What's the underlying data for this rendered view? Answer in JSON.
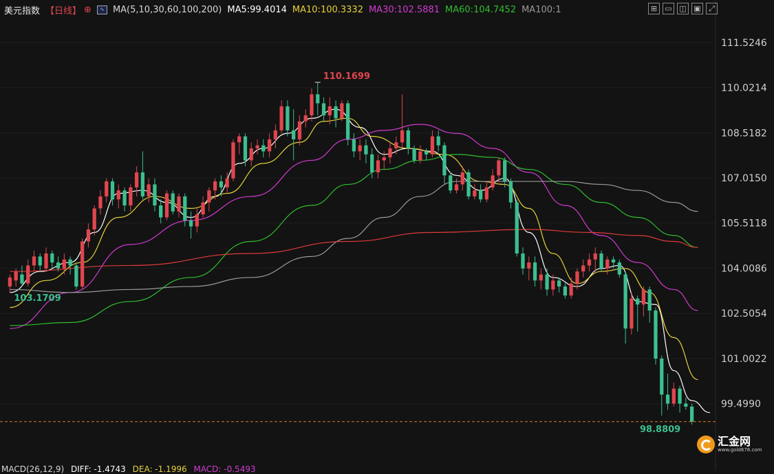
{
  "header": {
    "symbol": "美元指数",
    "period": "【日线】",
    "ma_params": "MA(5,10,30,60,100,200)",
    "ma5": "MA5:99.4014",
    "ma10": "MA10:100.3332",
    "ma30": "MA30:102.5881",
    "ma60": "MA60:104.7452",
    "ma100": "MA100:1"
  },
  "toolbar_icons": [
    "grid-icon",
    "window-icon",
    "split-icon",
    "window-alt-icon",
    "fullscreen-icon"
  ],
  "macd": {
    "params": "MACD(26,12,9)",
    "diff": "DIFF: -1.4743",
    "dea": "DEA: -1.1996",
    "macd": "MACD: -0.5493"
  },
  "price_annotations": {
    "high_label": "110.1699",
    "low_label": "103.1709",
    "last_label": "98.8809"
  },
  "logo": {
    "name": "汇金网",
    "url": "www.gold678.com"
  },
  "colors": {
    "up": "#e0464e",
    "down": "#3cbf8f",
    "ma5": "#ffffff",
    "ma10": "#e6d23a",
    "ma30": "#d23bd2",
    "ma60": "#2fbf2f",
    "ma100": "#9a9a9a",
    "ma200": "#e03a3a",
    "last_price_line": "#e07b2a"
  },
  "chart_data": {
    "type": "candlestick",
    "y_tick_labels": [
      "111.5246",
      "110.0214",
      "108.5182",
      "107.0150",
      "105.5118",
      "104.0086",
      "102.5054",
      "101.0022",
      "99.4990"
    ],
    "ylim": [
      98.3,
      112.3
    ],
    "candles": [
      [
        103.4,
        103.7,
        103.2,
        103.8
      ],
      [
        103.6,
        103.9,
        103.4,
        104.0
      ],
      [
        103.8,
        103.5,
        103.4,
        104.1
      ],
      [
        103.5,
        104.1,
        103.4,
        104.3
      ],
      [
        104.1,
        104.4,
        103.9,
        104.6
      ],
      [
        104.4,
        104.1,
        103.9,
        104.5
      ],
      [
        104.0,
        104.5,
        103.9,
        104.7
      ],
      [
        104.5,
        104.2,
        104.0,
        104.6
      ],
      [
        104.2,
        104.0,
        103.9,
        104.4
      ],
      [
        104.0,
        104.3,
        103.8,
        104.5
      ],
      [
        104.3,
        104.1,
        103.8,
        104.4
      ],
      [
        104.1,
        103.4,
        103.3,
        104.2
      ],
      [
        103.4,
        104.9,
        103.3,
        105.0
      ],
      [
        104.9,
        105.3,
        104.7,
        105.5
      ],
      [
        105.3,
        106.0,
        105.1,
        106.1
      ],
      [
        106.0,
        106.4,
        105.8,
        106.6
      ],
      [
        106.4,
        106.9,
        106.2,
        107.0
      ],
      [
        106.9,
        106.3,
        106.1,
        107.0
      ],
      [
        106.3,
        106.6,
        106.0,
        106.8
      ],
      [
        106.6,
        106.1,
        105.9,
        106.7
      ],
      [
        106.1,
        106.7,
        105.9,
        106.8
      ],
      [
        106.7,
        107.2,
        106.4,
        107.4
      ],
      [
        107.2,
        106.4,
        106.3,
        107.9
      ],
      [
        106.4,
        106.8,
        106.2,
        107.0
      ],
      [
        106.8,
        106.1,
        105.9,
        107.0
      ],
      [
        106.1,
        105.7,
        105.5,
        106.3
      ],
      [
        105.7,
        106.5,
        105.6,
        106.6
      ],
      [
        106.5,
        105.9,
        105.8,
        106.6
      ],
      [
        105.9,
        106.4,
        105.7,
        106.5
      ],
      [
        106.4,
        105.6,
        105.4,
        106.5
      ],
      [
        105.6,
        105.4,
        105.0,
        105.9
      ],
      [
        105.4,
        105.8,
        105.2,
        106.0
      ],
      [
        105.8,
        106.2,
        105.7,
        106.4
      ],
      [
        106.2,
        106.6,
        105.9,
        106.7
      ],
      [
        106.6,
        106.9,
        106.3,
        107.0
      ],
      [
        106.9,
        106.7,
        106.4,
        107.1
      ],
      [
        106.7,
        107.0,
        106.5,
        107.2
      ],
      [
        107.0,
        108.2,
        106.9,
        108.3
      ],
      [
        108.2,
        108.4,
        107.8,
        108.5
      ],
      [
        108.4,
        107.6,
        107.4,
        108.5
      ],
      [
        107.6,
        108.0,
        107.4,
        108.2
      ],
      [
        108.0,
        108.1,
        107.8,
        108.3
      ],
      [
        108.1,
        107.9,
        107.7,
        108.3
      ],
      [
        107.9,
        108.3,
        107.7,
        108.5
      ],
      [
        108.3,
        108.6,
        108.0,
        108.8
      ],
      [
        108.6,
        109.4,
        108.5,
        109.6
      ],
      [
        109.4,
        108.6,
        108.4,
        109.6
      ],
      [
        108.6,
        108.3,
        107.6,
        109.3
      ],
      [
        108.3,
        108.9,
        108.1,
        109.1
      ],
      [
        108.9,
        109.1,
        108.7,
        109.3
      ],
      [
        109.1,
        109.8,
        108.9,
        110.0
      ],
      [
        109.8,
        109.5,
        109.1,
        110.2
      ],
      [
        109.5,
        109.1,
        108.9,
        109.7
      ],
      [
        109.1,
        109.4,
        108.8,
        109.7
      ],
      [
        109.4,
        109.0,
        108.7,
        109.6
      ],
      [
        109.0,
        109.5,
        108.9,
        109.6
      ],
      [
        109.5,
        108.3,
        108.1,
        109.6
      ],
      [
        108.3,
        107.9,
        107.7,
        108.5
      ],
      [
        107.9,
        108.1,
        107.6,
        108.3
      ],
      [
        108.1,
        107.8,
        107.5,
        108.3
      ],
      [
        107.8,
        107.2,
        107.0,
        108.0
      ],
      [
        107.2,
        107.6,
        107.0,
        107.8
      ],
      [
        107.6,
        107.7,
        107.3,
        107.9
      ],
      [
        107.7,
        108.0,
        107.5,
        108.2
      ],
      [
        108.0,
        108.2,
        107.8,
        108.4
      ],
      [
        108.2,
        108.6,
        108.0,
        109.8
      ],
      [
        108.6,
        108.0,
        107.8,
        108.7
      ],
      [
        108.0,
        107.6,
        107.5,
        108.1
      ],
      [
        107.6,
        107.9,
        107.5,
        108.1
      ],
      [
        107.9,
        107.8,
        107.6,
        108.0
      ],
      [
        107.8,
        108.4,
        107.7,
        108.6
      ],
      [
        108.4,
        108.1,
        107.9,
        108.6
      ],
      [
        108.1,
        107.1,
        106.8,
        108.2
      ],
      [
        107.1,
        106.6,
        106.5,
        107.2
      ],
      [
        106.6,
        106.8,
        106.5,
        107.0
      ],
      [
        106.8,
        107.2,
        106.6,
        107.4
      ],
      [
        107.2,
        106.4,
        106.3,
        107.3
      ],
      [
        106.4,
        106.6,
        106.3,
        106.8
      ],
      [
        106.6,
        106.3,
        106.2,
        106.8
      ],
      [
        106.3,
        106.7,
        106.2,
        106.9
      ],
      [
        106.7,
        107.1,
        106.6,
        107.3
      ],
      [
        107.1,
        107.6,
        106.9,
        107.7
      ],
      [
        107.6,
        106.9,
        106.7,
        107.7
      ],
      [
        106.9,
        106.2,
        106.0,
        107.0
      ],
      [
        106.2,
        104.5,
        104.4,
        106.3
      ],
      [
        104.5,
        104.0,
        103.8,
        104.7
      ],
      [
        104.0,
        104.2,
        103.6,
        104.4
      ],
      [
        104.2,
        103.6,
        103.4,
        104.4
      ],
      [
        103.6,
        103.8,
        103.3,
        104.0
      ],
      [
        103.8,
        103.3,
        103.1,
        104.0
      ],
      [
        103.3,
        103.6,
        103.1,
        103.8
      ],
      [
        103.6,
        103.4,
        103.2,
        103.7
      ],
      [
        103.4,
        103.1,
        103.0,
        103.5
      ],
      [
        103.1,
        103.5,
        103.0,
        103.7
      ],
      [
        103.5,
        103.9,
        103.3,
        104.0
      ],
      [
        103.9,
        104.1,
        103.7,
        104.3
      ],
      [
        104.1,
        104.3,
        103.9,
        104.5
      ],
      [
        104.3,
        104.5,
        103.9,
        104.7
      ],
      [
        104.5,
        104.0,
        103.9,
        104.6
      ],
      [
        104.0,
        104.3,
        103.8,
        104.4
      ],
      [
        104.3,
        104.2,
        104.0,
        104.4
      ],
      [
        104.2,
        103.8,
        103.7,
        104.3
      ],
      [
        103.8,
        102.0,
        101.5,
        103.9
      ],
      [
        102.0,
        103.0,
        101.8,
        103.2
      ],
      [
        103.0,
        102.8,
        101.9,
        103.1
      ],
      [
        102.8,
        103.3,
        102.4,
        103.4
      ],
      [
        103.3,
        102.6,
        102.2,
        103.4
      ],
      [
        102.6,
        101.0,
        100.8,
        102.7
      ],
      [
        101.0,
        99.8,
        99.1,
        101.1
      ],
      [
        99.8,
        99.5,
        99.3,
        100.5
      ],
      [
        99.5,
        100.0,
        99.4,
        100.2
      ],
      [
        100.0,
        99.5,
        99.2,
        100.1
      ],
      [
        99.5,
        99.4,
        99.3,
        99.7
      ],
      [
        99.4,
        98.9,
        98.8,
        99.5
      ]
    ],
    "moving_averages": [
      {
        "name": "MA5",
        "points": [
          [
            0,
            103.2
          ],
          [
            5,
            103.9
          ],
          [
            10,
            104.2
          ],
          [
            14,
            105.2
          ],
          [
            18,
            106.5
          ],
          [
            22,
            106.6
          ],
          [
            26,
            106.2
          ],
          [
            30,
            105.7
          ],
          [
            34,
            106.4
          ],
          [
            38,
            107.5
          ],
          [
            42,
            108.0
          ],
          [
            46,
            108.5
          ],
          [
            50,
            109.0
          ],
          [
            54,
            109.3
          ],
          [
            58,
            108.7
          ],
          [
            62,
            107.8
          ],
          [
            66,
            108.0
          ],
          [
            70,
            107.9
          ],
          [
            74,
            107.1
          ],
          [
            78,
            106.6
          ],
          [
            82,
            107.0
          ],
          [
            86,
            105.2
          ],
          [
            90,
            103.7
          ],
          [
            94,
            103.4
          ],
          [
            98,
            104.0
          ],
          [
            101,
            104.1
          ],
          [
            104,
            102.9
          ],
          [
            107,
            102.8
          ],
          [
            110,
            100.6
          ],
          [
            113,
            99.6
          ],
          [
            116,
            99.2
          ]
        ]
      },
      {
        "name": "MA10",
        "points": [
          [
            0,
            102.7
          ],
          [
            6,
            103.6
          ],
          [
            12,
            104.2
          ],
          [
            18,
            105.7
          ],
          [
            24,
            106.4
          ],
          [
            30,
            106.0
          ],
          [
            36,
            106.5
          ],
          [
            42,
            107.5
          ],
          [
            48,
            108.2
          ],
          [
            52,
            108.9
          ],
          [
            56,
            109.0
          ],
          [
            60,
            108.4
          ],
          [
            66,
            108.0
          ],
          [
            72,
            107.8
          ],
          [
            78,
            106.9
          ],
          [
            82,
            106.8
          ],
          [
            86,
            106.0
          ],
          [
            90,
            104.5
          ],
          [
            94,
            103.5
          ],
          [
            98,
            103.9
          ],
          [
            102,
            104.0
          ],
          [
            106,
            103.2
          ],
          [
            110,
            101.7
          ],
          [
            114,
            100.3
          ]
        ]
      },
      {
        "name": "MA30",
        "points": [
          [
            0,
            102.0
          ],
          [
            10,
            103.2
          ],
          [
            20,
            104.8
          ],
          [
            30,
            105.6
          ],
          [
            40,
            106.4
          ],
          [
            50,
            107.6
          ],
          [
            56,
            108.3
          ],
          [
            62,
            108.6
          ],
          [
            68,
            108.8
          ],
          [
            74,
            108.5
          ],
          [
            80,
            108.0
          ],
          [
            86,
            107.2
          ],
          [
            92,
            106.1
          ],
          [
            98,
            105.1
          ],
          [
            104,
            104.2
          ],
          [
            110,
            103.3
          ],
          [
            114,
            102.6
          ]
        ]
      },
      {
        "name": "MA60",
        "points": [
          [
            0,
            102.1
          ],
          [
            10,
            102.2
          ],
          [
            20,
            102.9
          ],
          [
            30,
            103.7
          ],
          [
            40,
            104.9
          ],
          [
            50,
            106.1
          ],
          [
            56,
            106.8
          ],
          [
            62,
            107.3
          ],
          [
            68,
            107.6
          ],
          [
            74,
            107.8
          ],
          [
            80,
            107.7
          ],
          [
            86,
            107.3
          ],
          [
            92,
            106.8
          ],
          [
            98,
            106.2
          ],
          [
            104,
            105.7
          ],
          [
            110,
            105.1
          ],
          [
            114,
            104.7
          ]
        ]
      },
      {
        "name": "MA100",
        "points": [
          [
            0,
            103.3
          ],
          [
            10,
            103.2
          ],
          [
            20,
            103.3
          ],
          [
            30,
            103.4
          ],
          [
            40,
            103.7
          ],
          [
            50,
            104.4
          ],
          [
            56,
            105.0
          ],
          [
            62,
            105.7
          ],
          [
            68,
            106.4
          ],
          [
            74,
            106.9
          ],
          [
            80,
            106.9
          ],
          [
            86,
            106.9
          ],
          [
            92,
            106.9
          ],
          [
            98,
            106.8
          ],
          [
            104,
            106.6
          ],
          [
            110,
            106.2
          ],
          [
            114,
            105.9
          ]
        ]
      },
      {
        "name": "MA200",
        "points": [
          [
            0,
            103.9
          ],
          [
            20,
            104.1
          ],
          [
            40,
            104.5
          ],
          [
            56,
            104.9
          ],
          [
            70,
            105.2
          ],
          [
            86,
            105.3
          ],
          [
            96,
            105.2
          ],
          [
            104,
            105.1
          ],
          [
            110,
            104.9
          ],
          [
            114,
            104.7
          ]
        ]
      }
    ]
  }
}
